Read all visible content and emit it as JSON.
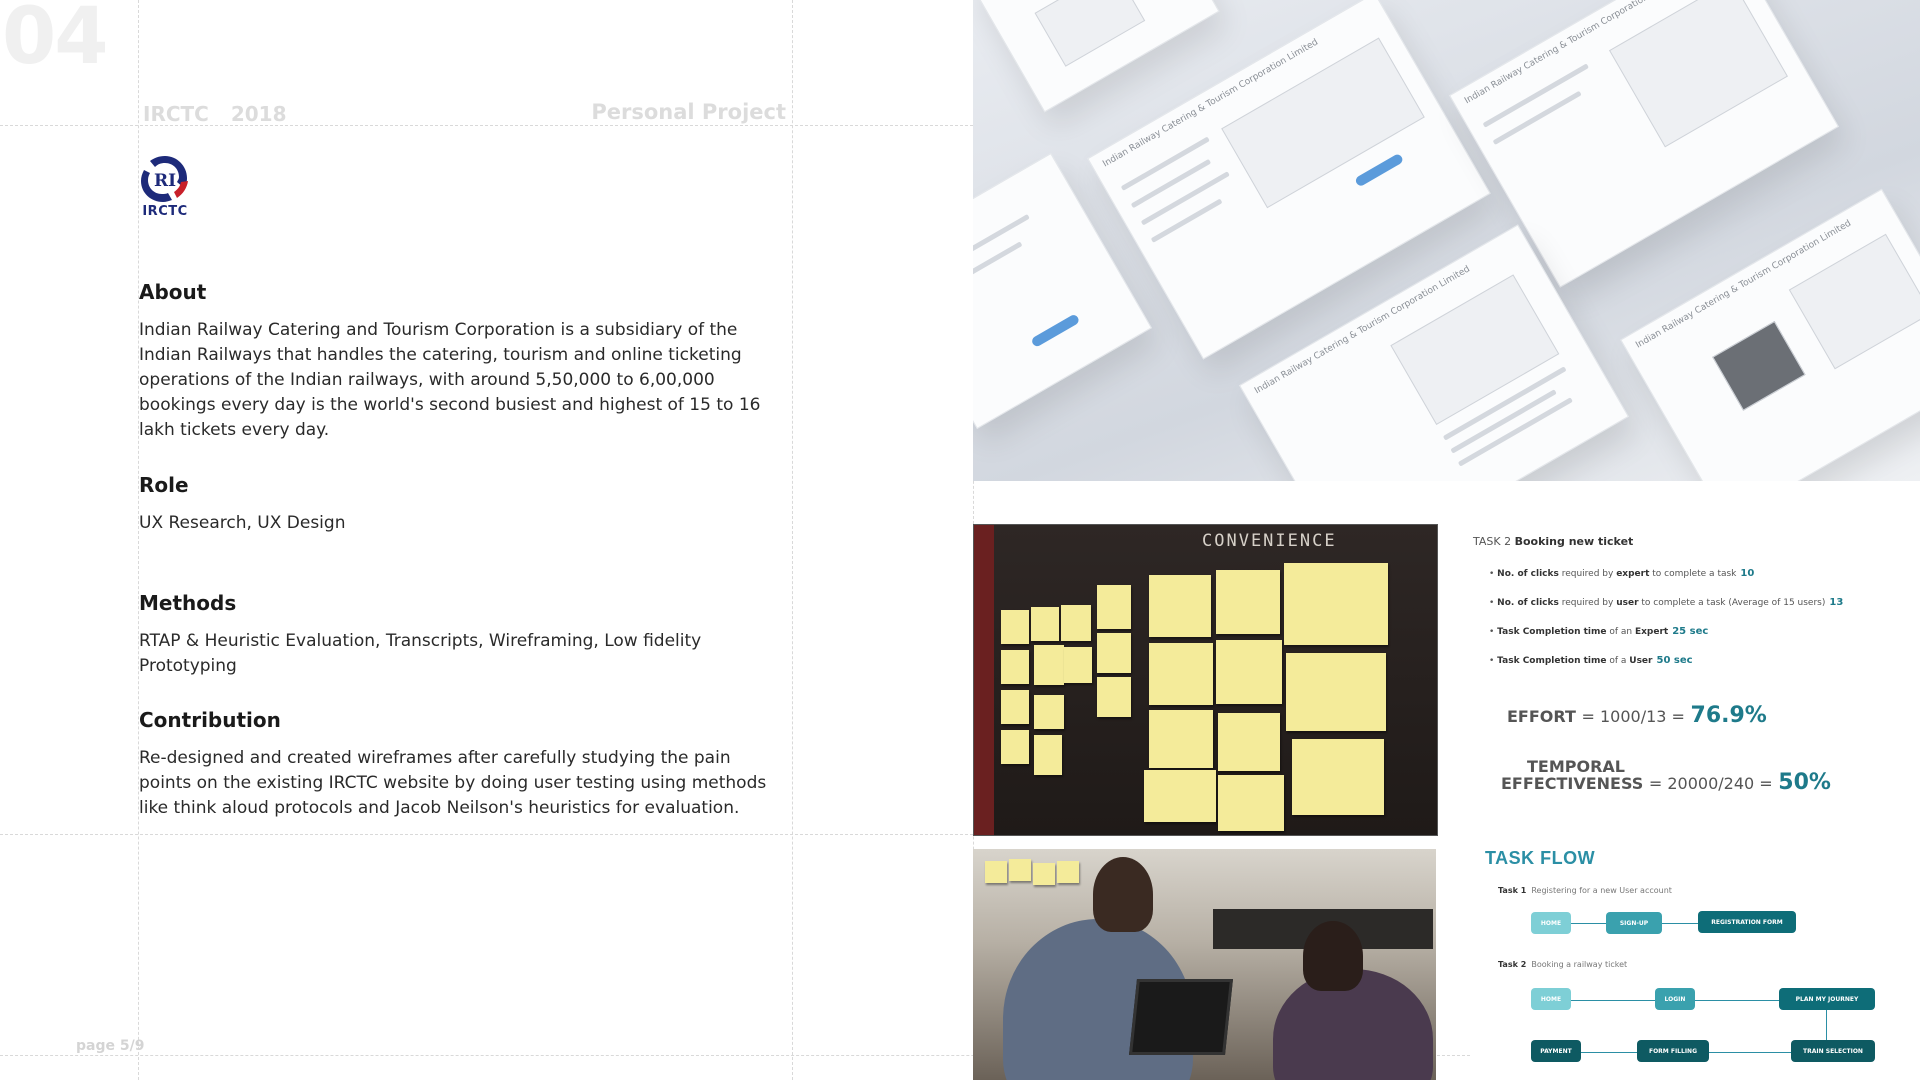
{
  "slide": {
    "number": "04",
    "project": "IRCTC",
    "year": "2018",
    "type": "Personal Project",
    "page": "page 5/9"
  },
  "logo": {
    "text": "IRCTC"
  },
  "sections": {
    "about": {
      "heading": "About",
      "body": "Indian Railway Catering and Tourism Corporation is a subsidiary of the Indian Railways that handles the catering, tourism and online ticketing operations of the Indian railways, with around 5,50,000 to 6,00,000 bookings every day is the world's second busiest and highest of 15 to 16 lakh tickets every day."
    },
    "role": {
      "heading": "Role",
      "body": "UX Research, UX Design"
    },
    "methods": {
      "heading": "Methods",
      "body": "RTAP & Heuristic Evaluation, Transcripts, Wireframing, Low fidelity Prototyping"
    },
    "contribution": {
      "heading": "Contribution",
      "body": "Re-designed and created wireframes after carefully studying the pain points on the existing IRCTC website by doing user testing using methods like think aloud protocols and Jacob Neilson's heuristics for evaluation."
    }
  },
  "wireframes": {
    "caption": "Indian Railway Catering & Tourism Corporation Limited"
  },
  "affinity_board": {
    "title": "CONVENIENCE"
  },
  "metrics": {
    "task_prefix": "TASK 2",
    "task_name": "Booking new ticket",
    "rows": [
      {
        "label_bold": "No. of clicks",
        "label_mid": " required by ",
        "who": "expert",
        "label_end": " to complete a task",
        "value": "10"
      },
      {
        "label_bold": "No. of clicks",
        "label_mid": " required by ",
        "who": "user",
        "label_end": " to complete a task (Average of 15 users)",
        "value": "13"
      },
      {
        "label_bold": "Task Completion time",
        "label_mid": " of an ",
        "who": "Expert",
        "label_end": "",
        "value": "25 sec"
      },
      {
        "label_bold": "Task Completion time",
        "label_mid": " of a ",
        "who": "User",
        "label_end": "",
        "value": "50 sec"
      }
    ],
    "effort": {
      "label": "EFFORT",
      "expr": "= 1000/13 =",
      "result": "76.9%"
    },
    "temporal": {
      "label1": "TEMPORAL",
      "label2": "EFFECTIVENESS",
      "expr": "= 20000/240 =",
      "result": "50%"
    }
  },
  "taskflow": {
    "title": "TASK FLOW",
    "task1": {
      "num": "Task 1",
      "desc": "Registering for a new User account",
      "nodes": [
        "Home",
        "Sign-up",
        "Registration form"
      ]
    },
    "task2": {
      "num": "Task 2",
      "desc": "Booking a railway ticket",
      "nodes": [
        "Home",
        "Login",
        "Plan my journey",
        "Payment",
        "Form filling",
        "Train selection"
      ]
    },
    "colors": {
      "light": "#7ecfd6",
      "mid": "#3aa1ae",
      "dark": "#0e6d78"
    }
  }
}
